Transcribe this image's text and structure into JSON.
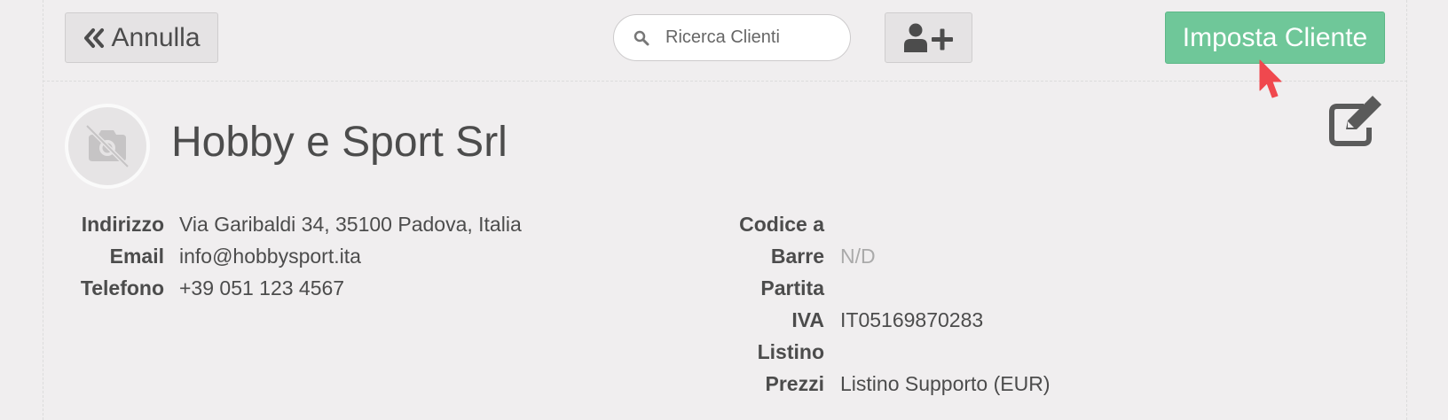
{
  "toolbar": {
    "cancel_label": "Annulla",
    "cancel_icon": "double-chevron-left-icon",
    "search_placeholder": "Ricerca Clienti",
    "search_icon": "search-icon",
    "add_user_icon": "add-user-icon",
    "set_client_label": "Imposta Cliente",
    "set_client_color": "#6fc799"
  },
  "client": {
    "name": "Hobby e Sport Srl",
    "avatar_icon": "no-photo-icon",
    "edit_icon": "edit-icon"
  },
  "details_left": [
    {
      "label": "Indirizzo",
      "value": "Via Garibaldi 34, 35100 Padova, Italia"
    },
    {
      "label": "Email",
      "value": "info@hobbysport.ita"
    },
    {
      "label": "Telefono",
      "value": "+39 051 123 4567"
    }
  ],
  "details_right": {
    "barcode_label_line1": "Codice a",
    "barcode_label_line2": "Barre",
    "barcode_value": "N/D",
    "vat_label_line1": "Partita",
    "vat_label_line2": "IVA",
    "vat_value": "IT05169870283",
    "pricelist_label_line1": "Listino",
    "pricelist_label_line2": "Prezzi",
    "pricelist_value": "Listino Supporto (EUR)"
  }
}
